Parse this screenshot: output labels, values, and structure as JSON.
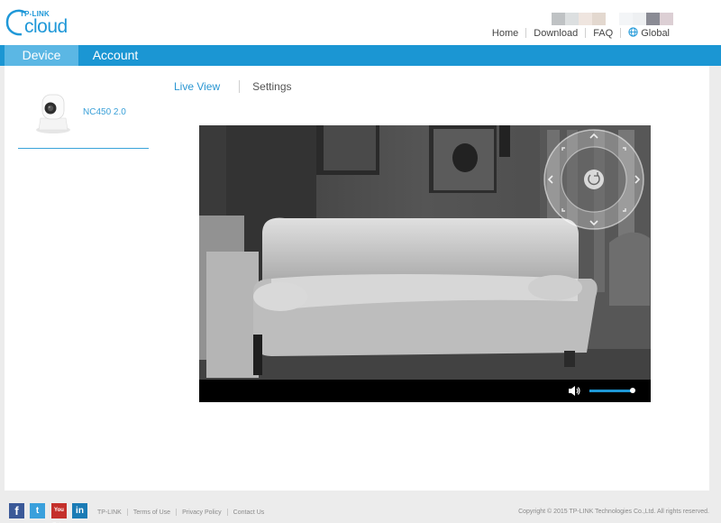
{
  "header": {
    "logo_small": "TP-LINK",
    "logo_big": "cloud",
    "swatches": [
      "#bfc2c4",
      "#dcdfe0",
      "#efe5df",
      "#e3d8cf",
      "#ffffff",
      "#f3f5f7",
      "#eef0f2",
      "#8a8b94",
      "#dccfd4"
    ],
    "links": {
      "home": "Home",
      "download": "Download",
      "faq": "FAQ",
      "global": "Global"
    }
  },
  "nav": {
    "device": "Device",
    "account": "Account"
  },
  "sidebar": {
    "device_name": "NC450 2.0"
  },
  "subtabs": {
    "live_view": "Live View",
    "settings": "Settings"
  },
  "player": {
    "volume_level": 0.95,
    "accent": "#1e97d5"
  },
  "footer": {
    "links": {
      "tplink": "TP-LINK",
      "terms": "Terms of Use",
      "privacy": "Privacy Policy",
      "contact": "Contact Us"
    },
    "social": {
      "facebook": "f",
      "twitter": "t",
      "youtube": "You Tube",
      "linkedin": "in"
    },
    "copyright": "Copyright © 2015 TP-LINK Technologies Co.,Ltd. All rights reserved."
  },
  "colors": {
    "brand": "#1b96d3",
    "active_tab": "#5bb7e4",
    "link": "#2a96d2"
  }
}
